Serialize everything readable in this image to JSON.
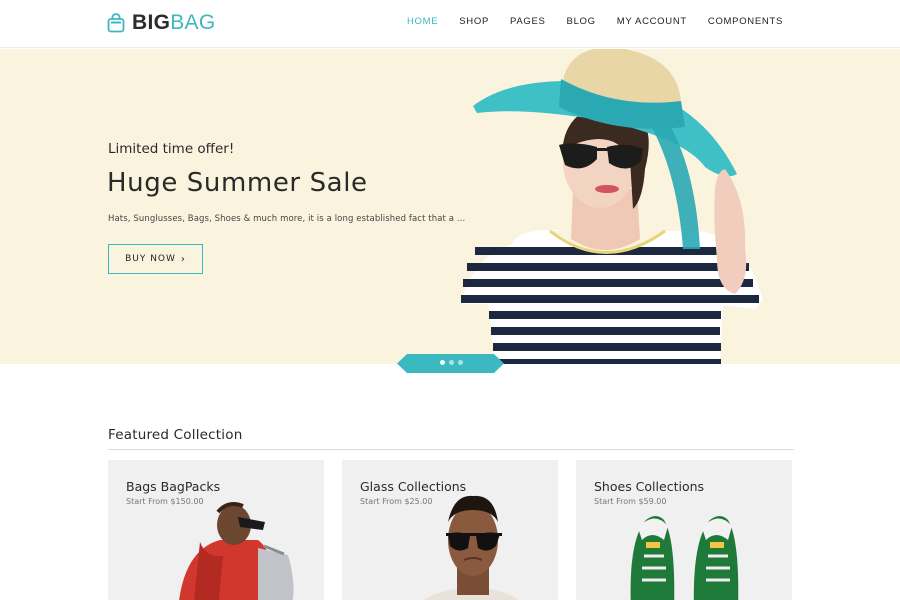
{
  "brand": {
    "part1": "BIG",
    "part2": "BAG"
  },
  "nav": {
    "items": [
      {
        "label": "HOME",
        "active": true
      },
      {
        "label": "SHOP"
      },
      {
        "label": "PAGES"
      },
      {
        "label": "BLOG"
      },
      {
        "label": "MY ACCOUNT"
      },
      {
        "label": "COMPONENTS"
      }
    ]
  },
  "hero": {
    "pretitle": "Limited time offer!",
    "title": "Huge Summer Sale",
    "description": "Hats, Sunglusses, Bags, Shoes & much more, it is a long established fact that a ...",
    "button_label": "BUY NOW",
    "button_icon": "chevron-right-icon",
    "slides_count": 3,
    "active_slide": 1
  },
  "featured": {
    "title": "Featured Collection",
    "cards": [
      {
        "title": "Bags BagPacks",
        "price": "Start From $150.00"
      },
      {
        "title": "Glass Collections",
        "price": "Start From $25.00"
      },
      {
        "title": "Shoes Collections",
        "price": "Start From $59.00"
      }
    ]
  },
  "colors": {
    "accent": "#3cb8c0",
    "hero_bg": "#faf4df",
    "card_bg": "#f0f0f0"
  }
}
